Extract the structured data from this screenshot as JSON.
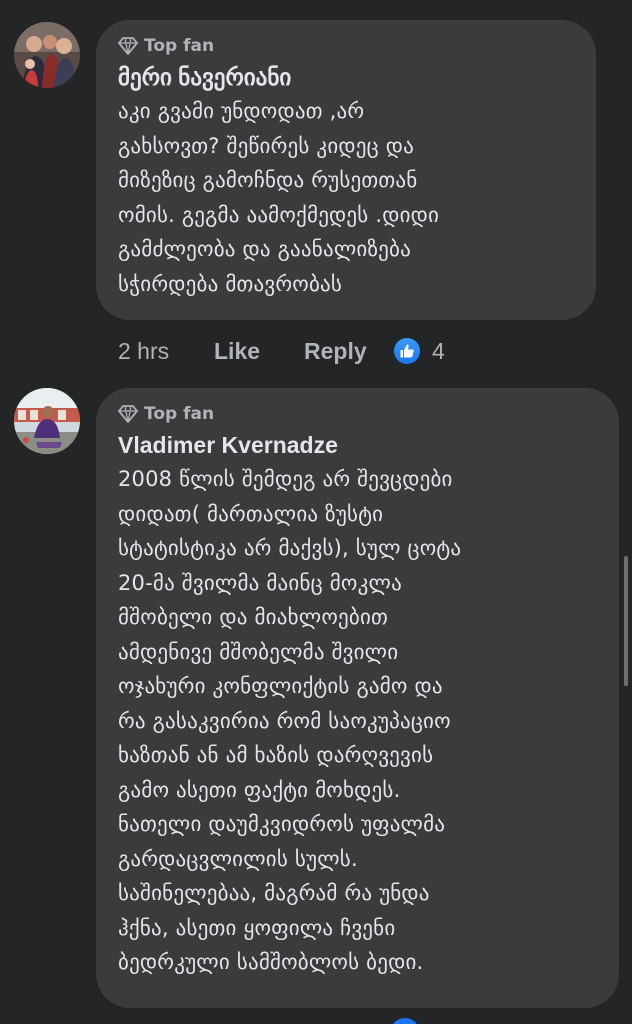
{
  "comments": [
    {
      "badge": "Top fan",
      "author": "მერი ნავერიანი",
      "text": "აკი გვამი უნდოდათ ,არ\nგახსოვთ? შეწირეს კიდეც და\nმიზეზიც გამოჩნდა რუსეთთან\nომის. გეგმა აამოქმედეს .დიდი\nგამძლეობა და გაანალიზება\nსჭირდება მთავრობას",
      "time": "2 hrs",
      "like_label": "Like",
      "reply_label": "Reply",
      "reaction_count": "4"
    },
    {
      "badge": "Top fan",
      "author": "Vladimer Kvernadze",
      "text": "2008 წლის შემდეგ არ შევცდები\nდიდათ( მართალია ზუსტი\nსტატისტიკა არ მაქვს), სულ ცოტა\n20-მა შვილმა მაინც მოკლა\nმშობელი და მიახლოებით\nამდენივე მშობელმა შვილი\nოჯახური კონფლიქტის გამო და\nრა გასაკვირია რომ საოკუპაციო\nხაზთან ან ამ ხაზის დარღვევის\nგამო ასეთი ფაქტი მოხდეს.\nნათელი დაუმკვიდროს უფალმა\nგარდაცვლილის სულს.\nსაშინელებაა, მაგრამ რა უნდა\nჰქნა, ასეთი ყოფილა ჩვენი\nბედრკული სამშობლოს ბედი."
    }
  ],
  "colors": {
    "background": "#242526",
    "bubble": "#3a3b3c",
    "text_primary": "#e4e6eb",
    "text_secondary": "#b0b3b8",
    "like_blue": "#1877f2"
  },
  "icons": {
    "badge_icon": "diamond-icon",
    "reaction_icon": "thumbs-up-icon"
  }
}
